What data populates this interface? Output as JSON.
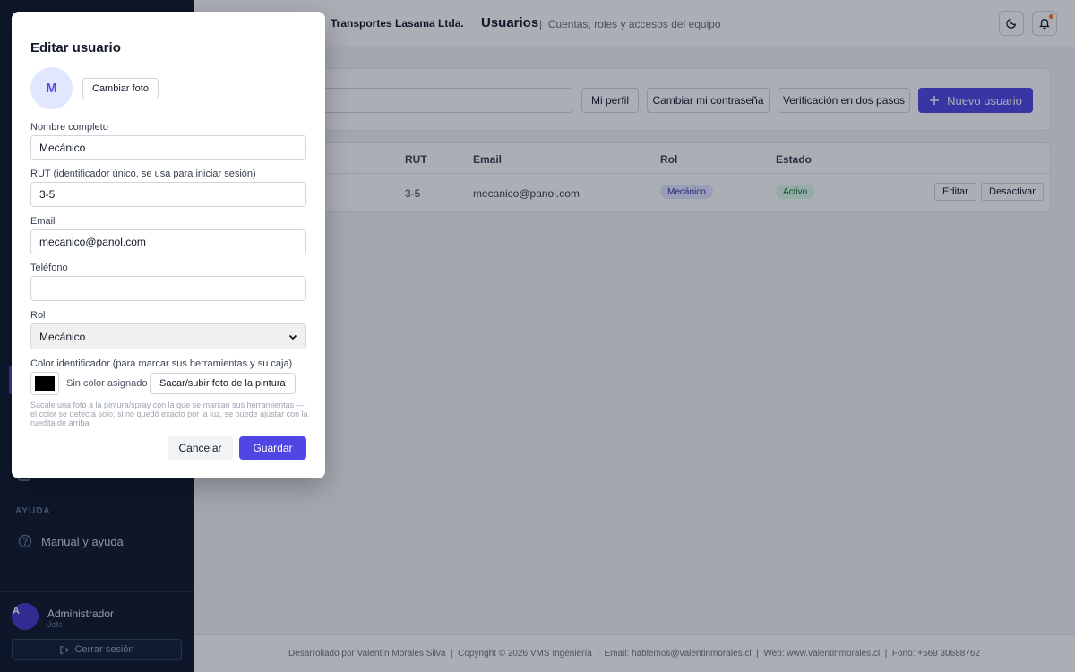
{
  "sidebar": {
    "section_help": "AYUDA",
    "help_item": "Manual y ayuda",
    "user": {
      "initial": "A",
      "name": "Administrador",
      "role": "Jefe"
    },
    "logout_label": "Cerrar sesión"
  },
  "header": {
    "company": "Transportes Lasama Ltda.",
    "title": "Usuarios",
    "subtitle": "Cuentas, roles y accesos del equipo"
  },
  "toolbar": {
    "my_profile": "Mi perfil",
    "change_password": "Cambiar mi contraseña",
    "two_step": "Verificación en dos pasos",
    "new_user": "Nuevo usuario"
  },
  "table": {
    "headers": [
      "RUT",
      "Email",
      "Rol",
      "Estado"
    ],
    "row": {
      "rut": "3-5",
      "email": "mecanico@panol.com",
      "role": "Mecánico",
      "status": "Activo",
      "edit": "Editar",
      "deactivate": "Desactivar"
    }
  },
  "footer": {
    "text": "Desarrollado por Valentín Morales Silva  |  Copyright © 2026 VMS Ingeniería  |  Email: hablemos@valentinmorales.cl  |  Web: www.valentinmorales.cl  |  Fono: +569 30688762"
  },
  "modal": {
    "title": "Editar usuario",
    "avatar_initial": "M",
    "change_photo": "Cambiar foto",
    "full_name_label": "Nombre completo",
    "full_name_value": "Mecánico",
    "rut_label": "RUT (identificador único, se usa para iniciar sesión)",
    "rut_value": "3-5",
    "email_label": "Email",
    "email_value": "mecanico@panol.com",
    "phone_label": "Teléfono",
    "phone_value": "",
    "role_label": "Rol",
    "role_value": "Mecánico",
    "color_label": "Color identificador (para marcar sus herramientas y su caja)",
    "no_color": "Sin color asignado",
    "photo_paint": "Sacar/subir foto de la pintura",
    "help": "Sacale una foto a la pintura/spray con la que se marcan sus herramientas — el color se detecta solo; si no quedó exacto por la luz, se puede ajustar con la ruedita de arriba.",
    "cancel": "Cancelar",
    "save": "Guardar"
  },
  "colors": {
    "accent": "#4f46e5",
    "sidebar_bg": "#0f172a",
    "swatch": "#000000"
  }
}
